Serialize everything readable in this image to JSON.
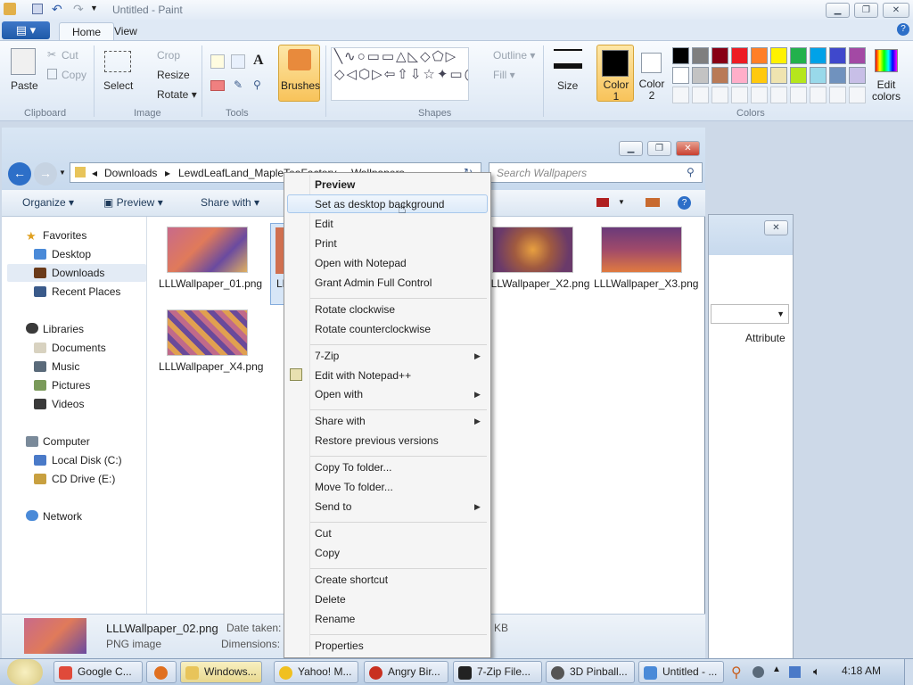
{
  "paint": {
    "title": "Untitled - Paint",
    "tabs": {
      "file": "▤ ▾",
      "home": "Home",
      "view": "View"
    },
    "clipboard": {
      "paste": "Paste",
      "cut": "Cut",
      "copy": "Copy",
      "group": "Clipboard"
    },
    "image": {
      "select": "Select",
      "crop": "Crop",
      "resize": "Resize",
      "rotate": "Rotate ▾",
      "group": "Image"
    },
    "tools": {
      "group": "Tools",
      "text_tool": "A"
    },
    "brushes": "Brushes",
    "shapes": {
      "outline": "Outline ▾",
      "fill": "Fill ▾",
      "group": "Shapes"
    },
    "size": "Size",
    "color1": "Color 1",
    "color2": "Color 2",
    "edit_colors": "Edit colors",
    "colors_group": "Colors",
    "palette_row1": [
      "#000000",
      "#7f7f7f",
      "#880015",
      "#ed1c24",
      "#ff7f27",
      "#fff200",
      "#22b14c",
      "#00a2e8",
      "#3f48cc",
      "#a349a4"
    ],
    "palette_row2": [
      "#ffffff",
      "#c3c3c3",
      "#b97a57",
      "#ffaec9",
      "#ffc90e",
      "#efe4b0",
      "#b5e61d",
      "#99d9ea",
      "#7092be",
      "#c8bfe7"
    ]
  },
  "explorer": {
    "breadcrumb": [
      "Downloads",
      "LewdLeafLand_MapleTeaFactory",
      "Wallpapers"
    ],
    "search_placeholder": "Search Wallpapers",
    "commands": {
      "organize": "Organize",
      "preview": "Preview",
      "share": "Share with"
    },
    "nav": {
      "favorites": "Favorites",
      "desktop": "Desktop",
      "downloads": "Downloads",
      "recent": "Recent Places",
      "libraries": "Libraries",
      "documents": "Documents",
      "music": "Music",
      "pictures": "Pictures",
      "videos": "Videos",
      "computer": "Computer",
      "local_disk": "Local Disk (C:)",
      "cd_drive": "CD Drive (E:)",
      "network": "Network"
    },
    "files": [
      "LLLWallpaper_01.png",
      "LLLWallpaper_X2.png",
      "LLLWallpaper_X3.png",
      "LLLWallpaper_X4.png"
    ],
    "partial_file_label": "LL",
    "details": {
      "name": "LLLWallpaper_02.png",
      "type": "PNG image",
      "date_label": "Date taken:",
      "dims_label": "Dimensions:",
      "size_suffix": "KB"
    }
  },
  "back_window": {
    "column": "Attribute"
  },
  "context_menu": [
    [
      "Preview",
      "Set as desktop background",
      "Edit",
      "Print",
      "Open with Notepad",
      "Grant Admin Full Control"
    ],
    [
      "Rotate clockwise",
      "Rotate counterclockwise"
    ],
    [
      "7-Zip",
      "Edit with Notepad++",
      "Open with"
    ],
    [
      "Share with",
      "Restore previous versions"
    ],
    [
      "Copy To folder...",
      "Move To folder...",
      "Send to"
    ],
    [
      "Cut",
      "Copy"
    ],
    [
      "Create shortcut",
      "Delete",
      "Rename"
    ],
    [
      "Properties"
    ]
  ],
  "taskbar": {
    "items": [
      "Google C...",
      "Windows...",
      "Yahoo! M...",
      "Angry Bir...",
      "7-Zip File...",
      "3D Pinball...",
      "Untitled - ..."
    ],
    "clock": "4:18 AM"
  }
}
